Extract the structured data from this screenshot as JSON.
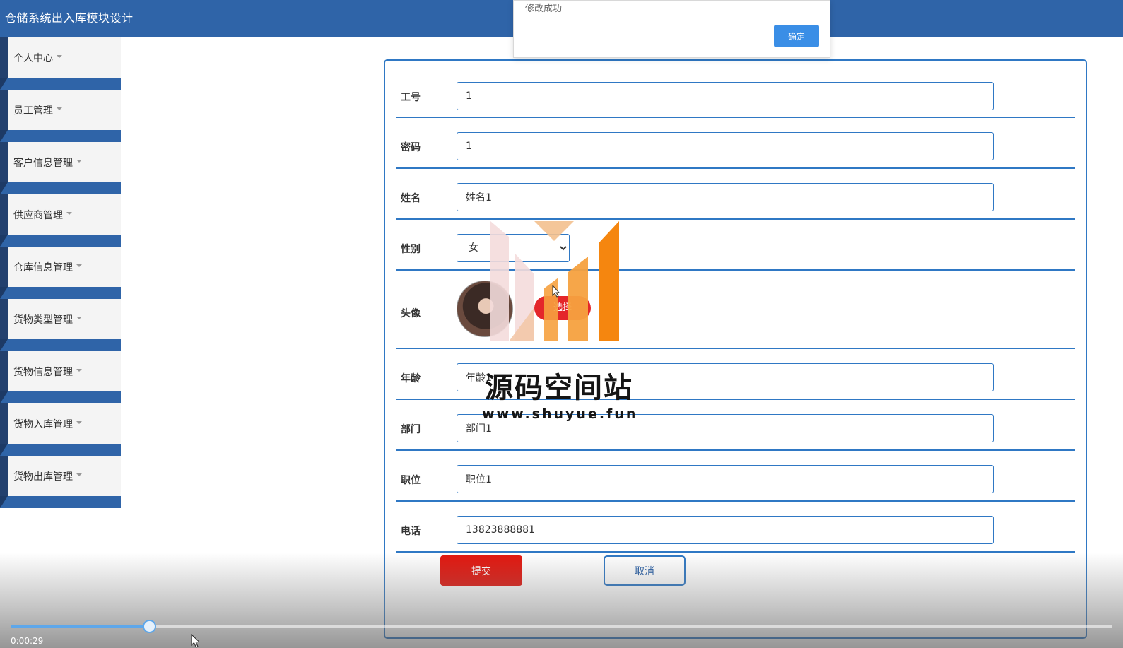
{
  "app": {
    "title": "仓储系统出入库模块设计"
  },
  "sidebar": {
    "items": [
      {
        "label": "个人中心"
      },
      {
        "label": "员工管理"
      },
      {
        "label": "客户信息管理"
      },
      {
        "label": "供应商管理"
      },
      {
        "label": "仓库信息管理"
      },
      {
        "label": "货物类型管理"
      },
      {
        "label": "货物信息管理"
      },
      {
        "label": "货物入库管理"
      },
      {
        "label": "货物出库管理"
      }
    ]
  },
  "dialog": {
    "message": "修改成功",
    "ok_label": "确定"
  },
  "form": {
    "fields": {
      "employee_id": {
        "label": "工号",
        "value": "1"
      },
      "password": {
        "label": "密码",
        "value": "1"
      },
      "name": {
        "label": "姓名",
        "value": "姓名1"
      },
      "gender": {
        "label": "性别",
        "value": "女"
      },
      "avatar": {
        "label": "头像",
        "button": "选择"
      },
      "age": {
        "label": "年龄",
        "value": "年龄1"
      },
      "department": {
        "label": "部门",
        "value": "部门1"
      },
      "position": {
        "label": "职位",
        "value": "职位1"
      },
      "phone": {
        "label": "电话",
        "value": "13823888881"
      }
    },
    "submit_label": "提交",
    "cancel_label": "取消"
  },
  "watermark": {
    "title": "源码空间站",
    "url": "www.shuyue.fun"
  },
  "player": {
    "time": "0:00:29",
    "progress": 0.125
  },
  "colors": {
    "header": "#2f64a8",
    "border": "#2f78c4",
    "submit": "#e2170f",
    "ok": "#3a8ee6"
  }
}
